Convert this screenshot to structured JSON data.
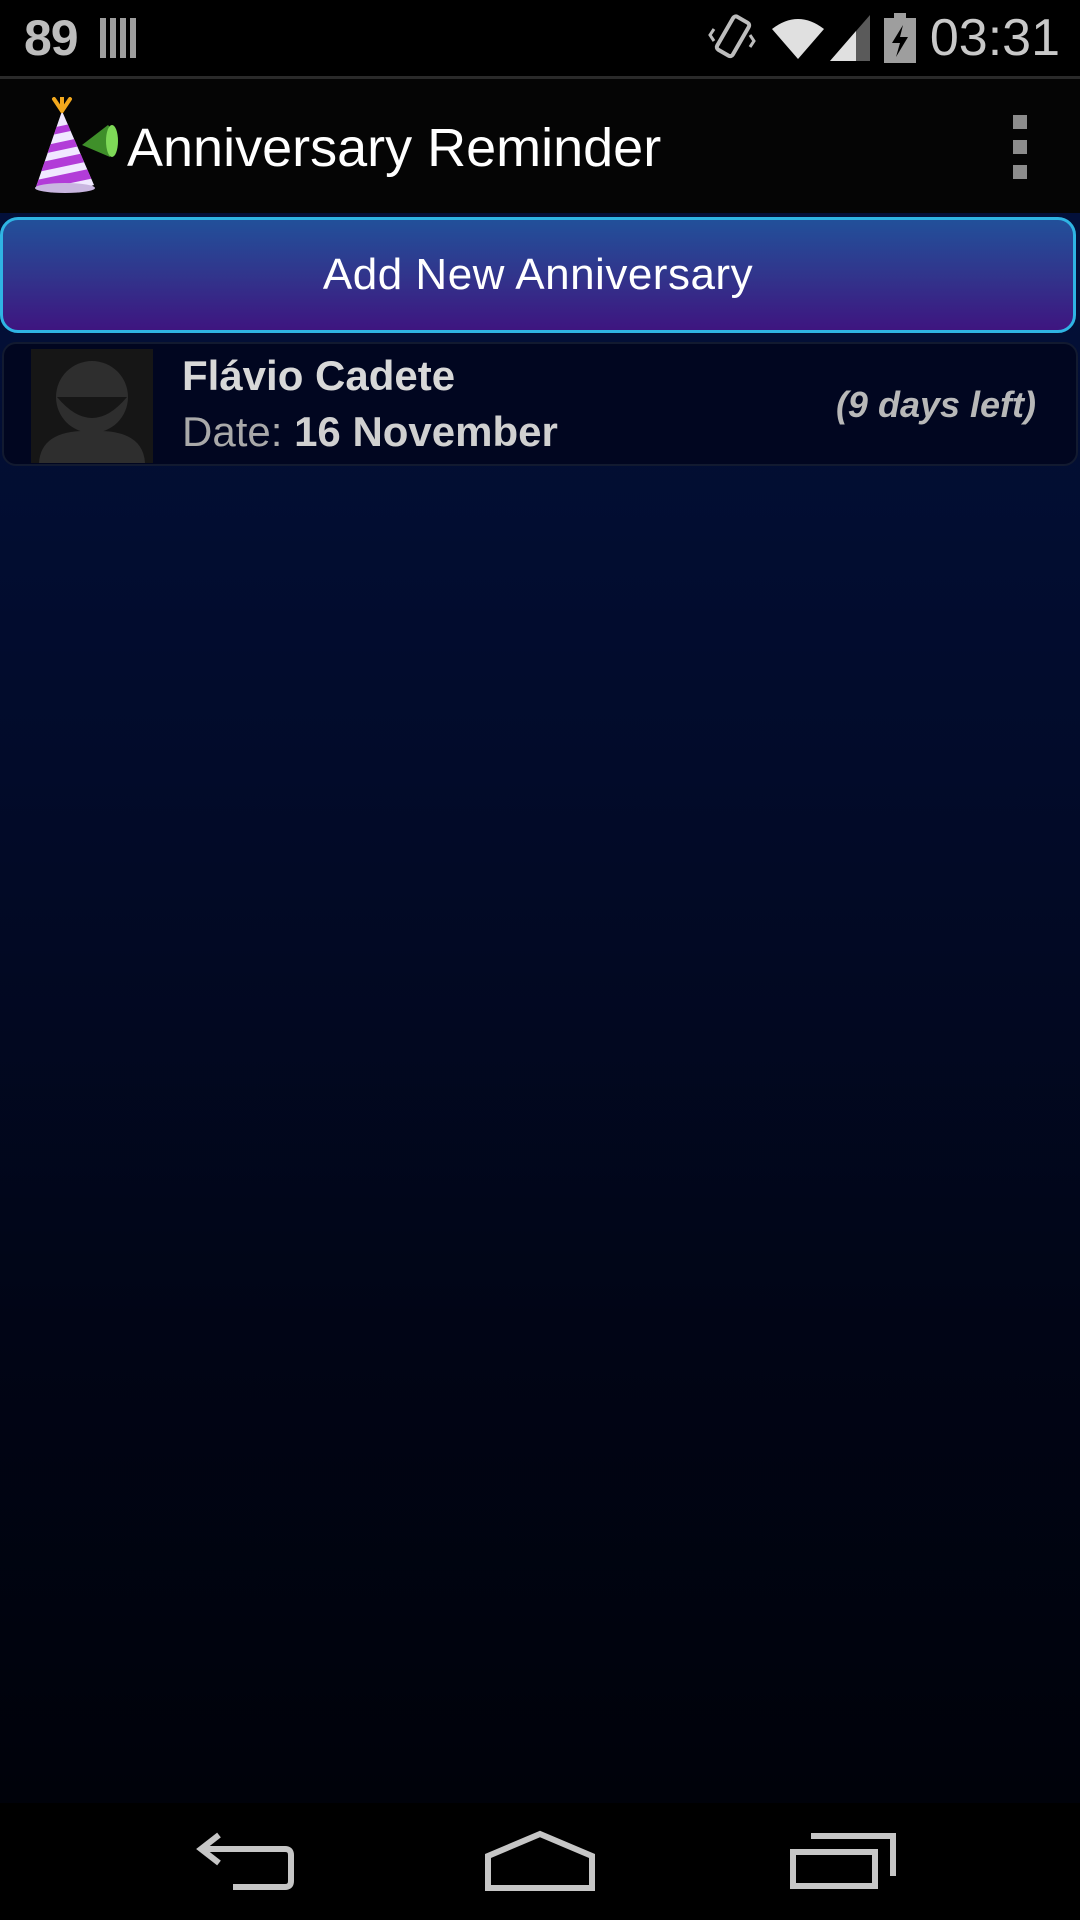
{
  "status_bar": {
    "notification_count": "89",
    "time": "03:31"
  },
  "action_bar": {
    "title": "Anniversary Reminder"
  },
  "main": {
    "add_button_label": "Add New Anniversary",
    "anniversaries": [
      {
        "name": "Flávio Cadete",
        "date_label": "Date:",
        "date_value": "16 November",
        "days_left": "(9 days left)"
      }
    ]
  },
  "colors": {
    "add_button_border": "#2fb4e4",
    "add_button_top": "#22509a",
    "add_button_bottom": "#3e1580",
    "background_top": "#03103a"
  },
  "icons": {
    "status_left": [
      "barcode-icon"
    ],
    "status_right": [
      "vibrate-icon",
      "wifi-icon",
      "signal-icon",
      "battery-charging-icon"
    ],
    "nav": [
      "back-icon",
      "home-icon",
      "recent-apps-icon"
    ]
  }
}
